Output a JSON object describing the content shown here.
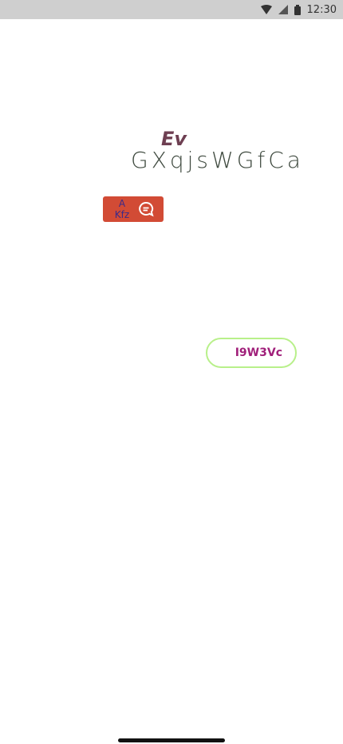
{
  "status_bar": {
    "time": "12:30",
    "icons": [
      "wifi-icon",
      "cell-signal-icon",
      "battery-icon"
    ]
  },
  "content": {
    "label_small": "Ev",
    "title": "GXqjsWGfCa",
    "red_button": {
      "label_line1": "A",
      "label_line2": "Kfz",
      "icon": "chat-bubble-icon"
    },
    "pill_button": {
      "label": "I9W3Vc"
    }
  },
  "colors": {
    "status_bar_bg": "#cfcfcf",
    "accent_red": "#d24b35",
    "title": "#3f4a3f",
    "label_small": "#6e3f52",
    "pill_border": "#b8f08a",
    "pill_text": "#a01f7a",
    "red_button_text": "#3b2a8a"
  }
}
